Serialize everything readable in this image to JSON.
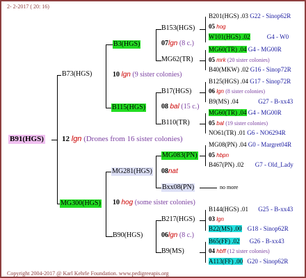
{
  "header": "2- 2-2017 ( 20: 16)",
  "footer": "Copyright 2004-2017 @ Karl Kehrle Foundation.   www.pedigreeapis.org",
  "root": {
    "name": "B91(HGS)",
    "year": "12",
    "breeder": "lgn",
    "note": "(Drones from 16 sister colonies)"
  },
  "sire": {
    "name": "B73(HGS)",
    "year": "10",
    "breeder": "lgn",
    "note": "(9 sister colonies)"
  },
  "dam": {
    "name": "MG300(HGS)",
    "year": "10",
    "breeder": "hog",
    "note": "(some sister colonies)"
  },
  "s_s": {
    "name": "B3(HGS)",
    "year": "07",
    "breeder": "lgn",
    "note": "(8 c.)"
  },
  "s_d": {
    "name": "B115(HGS)",
    "year": "08",
    "breeder": "bal",
    "note": "(15 c.)"
  },
  "d_s": {
    "name": "MG281(HGS)",
    "year": "08",
    "breeder": "nat"
  },
  "d_d": {
    "name": "B90(HGS)",
    "year": "06",
    "breeder": "lgn",
    "note": "(8 c.)"
  },
  "g1": {
    "name": "B153(HGS)"
  },
  "g2": {
    "name": "MG62(TR)"
  },
  "g3": {
    "name": "B17(HGS)"
  },
  "g4": {
    "name": "B110(TR)"
  },
  "g5": {
    "name": "MG083(PN)"
  },
  "g6": {
    "name": "Bxx08(PN)"
  },
  "g7": {
    "name": "B217(HGS)"
  },
  "g8": {
    "name": "B9(MS)"
  },
  "right": [
    {
      "a": "B201(HGS) .03",
      "b": "G22 - Sinop62R"
    },
    {
      "y": "05",
      "r": "hog"
    },
    {
      "a": "W101(HGS) .02",
      "b": "G4 - W0"
    },
    {
      "a": "MG60(TR) .04",
      "b": "G4 - MG00R"
    },
    {
      "y": "05",
      "r": "mrk",
      "n": "(20 sister colonies)"
    },
    {
      "a": "B40(MKW) .02",
      "b": "G16 - Sinop72R"
    },
    {
      "a": "B125(HGS) .04",
      "b": "G17 - Sinop72R"
    },
    {
      "y": "06",
      "r": "lgn",
      "n": "(8 sister colonies)"
    },
    {
      "a": "B9(MS) .04",
      "b": "G27 - B-xx43"
    },
    {
      "a": "MG60(TR) .04",
      "b": "G4 - MG00R"
    },
    {
      "y": "05",
      "r": "bal",
      "n": "(19 sister colonies)"
    },
    {
      "a": "NO61(TR) .01",
      "b": "G6 - NO6294R"
    },
    {
      "a": "MG08(PN) .04",
      "b": "G0 - Margret04R"
    },
    {
      "y": "05",
      "r": "hbpn"
    },
    {
      "a": "B467(PN) .02",
      "b": "G7 - Old_Lady"
    },
    {
      "m": "no more"
    },
    {
      "a": "B144(HGS) .01",
      "b": "G25 - B-xx43"
    },
    {
      "y": "03",
      "r": "lgn"
    },
    {
      "a": "B22(MS) .00",
      "b": "G18 - Sinop62R"
    },
    {
      "a": "B65(FF) .02",
      "b": "G26 - B-xx43"
    },
    {
      "y": "04",
      "r": "hbff",
      "n": "(12 sister colonies)"
    },
    {
      "a": "A113(FF) .00",
      "b": "G20 - Sinop62R"
    }
  ]
}
